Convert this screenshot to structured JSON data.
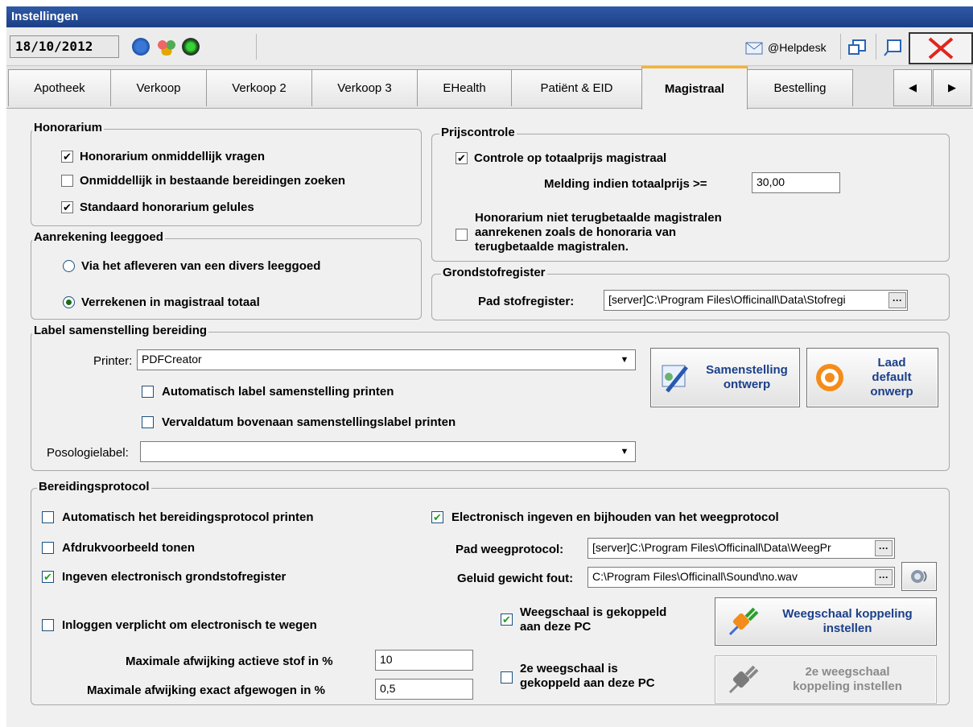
{
  "window": {
    "title": "Instellingen"
  },
  "toolbar": {
    "date": "18/10/2012",
    "helpdesk_label": "@Helpdesk"
  },
  "tabs": [
    {
      "label": "Apotheek"
    },
    {
      "label": "Verkoop"
    },
    {
      "label": "Verkoop 2"
    },
    {
      "label": "Verkoop 3"
    },
    {
      "label": "EHealth"
    },
    {
      "label": "Patiënt & EID"
    },
    {
      "label": "Magistraal",
      "active": true
    },
    {
      "label": "Bestelling"
    }
  ],
  "honorarium": {
    "title": "Honorarium",
    "opt1": {
      "label": "Honorarium onmiddellijk vragen",
      "checked": true
    },
    "opt2": {
      "label": "Onmiddellijk in bestaande bereidingen zoeken",
      "checked": false
    },
    "opt3": {
      "label": "Standaard honorarium gelules",
      "checked": true
    }
  },
  "leeggoed": {
    "title": "Aanrekening leeggoed",
    "opt1": {
      "label": "Via het afleveren van een divers leeggoed",
      "selected": false
    },
    "opt2": {
      "label": "Verrekenen in magistraal totaal",
      "selected": true
    }
  },
  "prijscontrole": {
    "title": "Prijscontrole",
    "controle": {
      "label": "Controle op totaalprijs magistraal",
      "checked": true
    },
    "melding_label": "Melding indien totaalprijs >=",
    "melding_value": "30,00",
    "honor_line1": "Honorarium niet terugbetaalde magistralen",
    "honor_line2": "aanrekenen zoals de honoraria van",
    "honor_line3": "terugbetaalde magistralen."
  },
  "grondstof": {
    "title": "Grondstofregister",
    "pad_label": "Pad stofregister:",
    "pad_value": "[server]C:\\Program Files\\Officinall\\Data\\Stofregi"
  },
  "label_groep": {
    "title": "Label samenstelling bereiding",
    "printer_label": "Printer:",
    "printer_value": "PDFCreator",
    "auto_label": "Automatisch label samenstelling printen",
    "verval_label": "Vervaldatum bovenaan samenstellingslabel printen",
    "posologie_label": "Posologielabel:",
    "posologie_value": "",
    "btn_samenstelling_1": "Samenstelling",
    "btn_samenstelling_2": "ontwerp",
    "btn_laad_1": "Laad",
    "btn_laad_2": "default",
    "btn_laad_3": "onwerp"
  },
  "protocol": {
    "title": "Bereidingsprotocol",
    "auto_print": "Automatisch het bereidingsprotocol printen",
    "afdruk": "Afdrukvoorbeeld tonen",
    "ingeven": "Ingeven electronisch grondstofregister",
    "inloggen": "Inloggen verplicht om electronisch te wegen",
    "afw_stof_label": "Maximale afwijking actieve stof in %",
    "afw_stof_value": "10",
    "afw_exact_label": "Maximale afwijking exact afgewogen in %",
    "afw_exact_value": "0,5",
    "electronisch": "Electronisch ingeven en bijhouden van het weegprotocol",
    "pad_weeg_label": "Pad weegprotocol:",
    "pad_weeg_value": "[server]C:\\Program Files\\Officinall\\Data\\WeegPr",
    "geluid_label": "Geluid gewicht fout:",
    "geluid_value": "C:\\Program Files\\Officinall\\Sound\\no.wav",
    "weeg1_line1": "Weegschaal is gekoppeld",
    "weeg1_line2": "aan deze PC",
    "weeg2_line1": "2e weegschaal is",
    "weeg2_line2": "gekoppeld aan deze PC",
    "btn_weeg_1": "Weegschaal koppeling",
    "btn_weeg_2": "instellen",
    "btn_weeg2_1": "2e weegschaal",
    "btn_weeg2_2": "koppeling instellen"
  },
  "colors": {
    "titlebar": "#1c3f86",
    "accent_tab": "#f4b33a",
    "close": "#e0261c",
    "button_text": "#1b3f8a"
  }
}
